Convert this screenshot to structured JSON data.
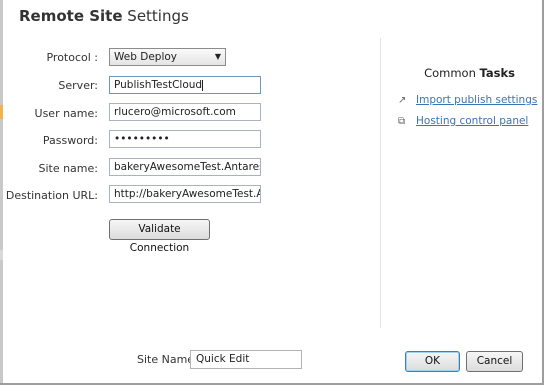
{
  "dialog": {
    "title_bold": "Remote Site",
    "title_rest": "Settings"
  },
  "form": {
    "protocol_label": "Protocol :",
    "protocol_value": "Web Deploy",
    "server_label": "Server:",
    "server_value": "PublishTestCloud",
    "username_label": "User name:",
    "username_value": "rlucero@microsoft.com",
    "password_label": "Password:",
    "password_value": "•••••••••",
    "sitename_label": "Site name:",
    "sitename_value": "bakeryAwesomeTest.AntaresCloud.c",
    "destination_label": "Destination URL:",
    "destination_value": "http://bakeryAwesomeTest.AntaresC",
    "validate_label": "Validate Connection"
  },
  "tasks": {
    "title_light": "Common",
    "title_bold": "Tasks",
    "items": [
      {
        "label": "Import publish settings",
        "icon": "import-icon"
      },
      {
        "label": "Hosting control panel",
        "icon": "panel-icon"
      }
    ]
  },
  "footer": {
    "site_name_label": "Site Name",
    "site_name_value": "Quick Edit",
    "ok_label": "OK",
    "cancel_label": "Cancel"
  }
}
